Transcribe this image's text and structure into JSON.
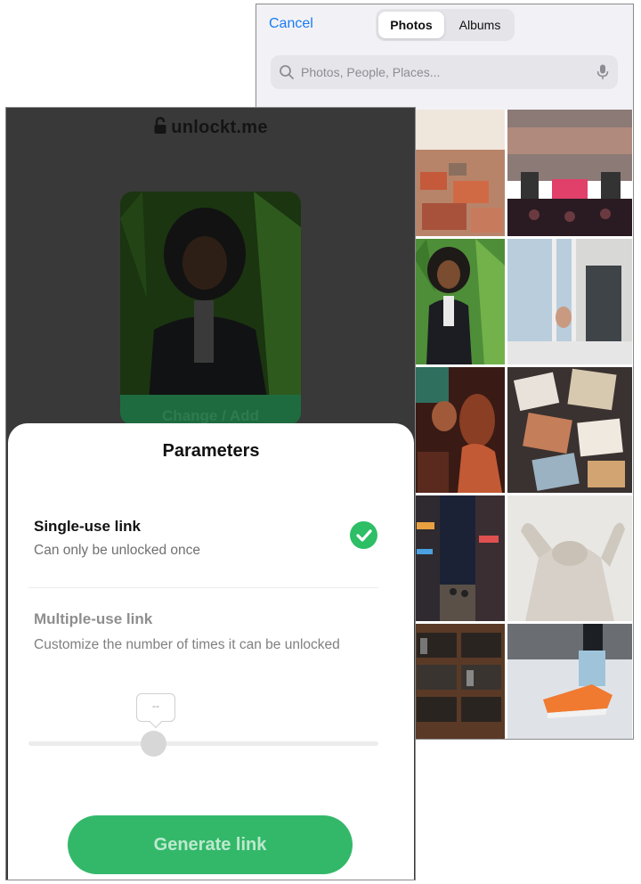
{
  "picker": {
    "cancel_label": "Cancel",
    "tabs": [
      {
        "label": "Photos",
        "selected": true
      },
      {
        "label": "Albums",
        "selected": false
      }
    ],
    "search": {
      "placeholder": "Photos, People, Places...",
      "value": ""
    },
    "accent_color": "#1a7bf2"
  },
  "app": {
    "brand": "unlockt.me",
    "change_label": "Change / Add",
    "sheet": {
      "title": "Parameters",
      "options": [
        {
          "title": "Single-use link",
          "subtitle": "Can only be unlocked once",
          "selected": true
        },
        {
          "title": "Multiple-use link",
          "subtitle": "Customize the number of times it can be unlocked",
          "selected": false
        }
      ],
      "slider": {
        "tooltip": "--",
        "level": 0.36
      },
      "generate_label": "Generate link"
    },
    "accent_color": "#2dbe66"
  }
}
